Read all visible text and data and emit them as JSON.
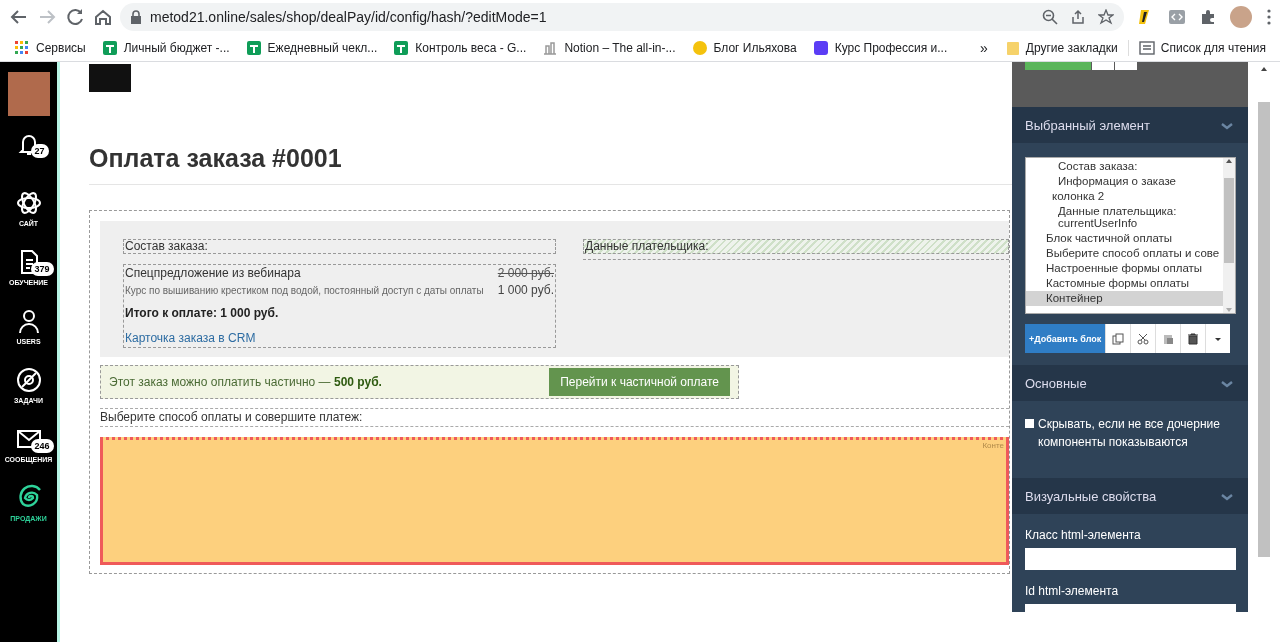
{
  "browser": {
    "url": "metod21.online/sales/shop/dealPay/id/config/hash/?editMode=1",
    "bookmarks": [
      {
        "label": "Сервисы"
      },
      {
        "label": "Личный бюджет -..."
      },
      {
        "label": "Ежедневный чекл..."
      },
      {
        "label": "Контроль веса - G..."
      },
      {
        "label": "Notion – The all-in-..."
      },
      {
        "label": "Блог Ильяхова"
      },
      {
        "label": "Курс Профессия и..."
      }
    ],
    "overflow": "»",
    "other_bookmarks": "Другие закладки",
    "reading_list": "Список для чтения"
  },
  "rail": {
    "items": [
      {
        "badge": "27",
        "selected": false
      },
      {
        "label": "САЙТ",
        "selected": false
      },
      {
        "label": "ОБУЧЕНИЕ",
        "badge": "379",
        "selected": false
      },
      {
        "label": "USERS",
        "selected": false
      },
      {
        "label": "ЗАДАЧИ",
        "selected": false
      },
      {
        "label": "СООБЩЕНИЯ",
        "badge": "246",
        "selected": false
      },
      {
        "label": "ПРОДАЖИ",
        "selected": true
      }
    ]
  },
  "page": {
    "title": "Оплата заказа #0001",
    "order": {
      "heading": "Состав заказа:",
      "item_name": "Спецпредложение из вебинара",
      "old_price": "2 000 руб.",
      "description": "Курс по вышиванию крестиком под водой, постоянный доступ с даты оплаты",
      "price": "1 000 руб.",
      "total": "Итого к оплате: 1 000 руб.",
      "crm_link": "Карточка заказа в CRM"
    },
    "payer_heading": "Данные плательщика:",
    "partial": {
      "text": "Этот заказ можно оплатить частично — **500 руб.**",
      "button": "Перейти к частичной оплате"
    },
    "payment_prompt": "Выберите способ оплаты и совершите платеж:",
    "container_label": "Конте"
  },
  "panel": {
    "selected_header": "Выбранный элемент",
    "tree": [
      {
        "children": [
          {
            "children": [
              {
                "label": "Состав заказа:",
                "selected": false
              },
              {
                "label": "Информация о заказе",
                "selected": false
              }
            ]
          },
          {
            "label": "колонка 2",
            "selected": false,
            "children": [
              {
                "label": "Данные плательщика: currentUserInfo",
                "selected": false
              }
            ]
          }
        ]
      },
      {
        "label": "Блок частичной оплаты",
        "selected": false
      },
      {
        "label": "Выберите способ оплаты и сове",
        "selected": false
      },
      {
        "label": "Настроенные формы оплаты",
        "selected": false
      },
      {
        "label": "Кастомные формы оплаты",
        "selected": false
      },
      {
        "label": "Контейнер",
        "selected": true
      }
    ],
    "add_button": "+Добавить блок",
    "basic_header": "Основные",
    "hide_checkbox": {
      "label": "Скрывать, если не все дочерние компоненты показываются",
      "checked": false
    },
    "visual_header": "Визуальные свойства",
    "fields": [
      {
        "label": "Класс html-элемента"
      },
      {
        "label": "Id html-элемента"
      }
    ]
  }
}
